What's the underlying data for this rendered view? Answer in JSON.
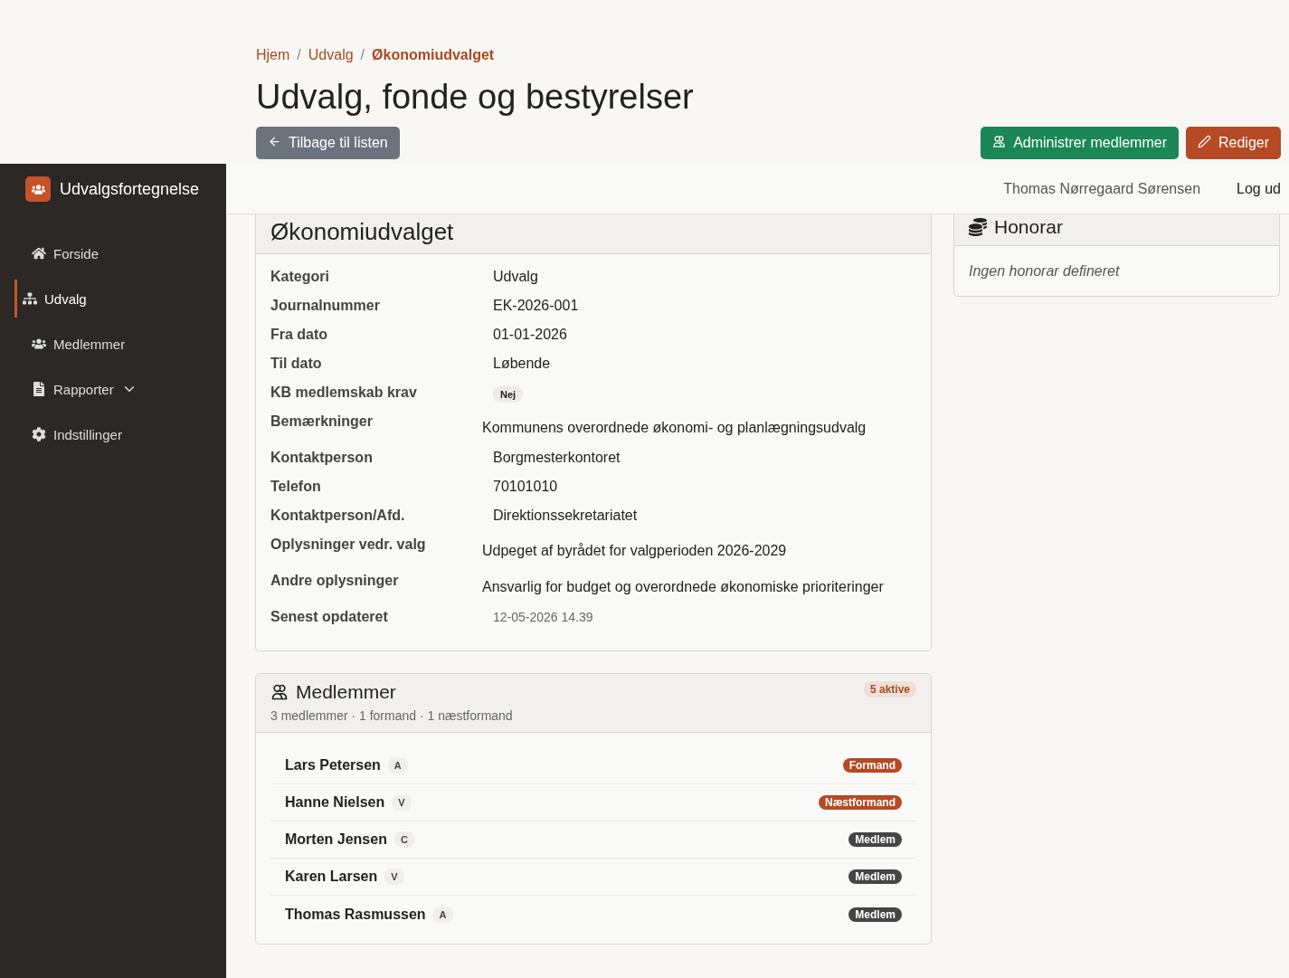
{
  "breadcrumb": [
    {
      "label": "Hjem",
      "current": false
    },
    {
      "separator": "/",
      "label": "Udvalg",
      "current": false
    },
    {
      "separator": "/",
      "label": "Økonomiudvalget",
      "current": true
    }
  ],
  "page_title": "Udvalg, fonde og bestyrelser",
  "actions": [
    {
      "label": "Tilbage til listen",
      "kind": "back"
    },
    {
      "label": "Administrer medlemmer",
      "kind": "members"
    },
    {
      "label": "Rediger",
      "kind": "edit"
    }
  ],
  "sidebar": {
    "brand": "Udvalgsfortegnelse",
    "items": [
      {
        "label": "Forside",
        "selected": false
      },
      {
        "label": "Udvalg",
        "selected": true
      },
      {
        "label": "Medlemmer",
        "selected": false
      },
      {
        "label": "Rapporter",
        "selected": false,
        "has_menu": true
      },
      {
        "label": "Indstillinger",
        "selected": false
      }
    ]
  },
  "navbar": {
    "user": "Thomas Nørregaard Sørensen",
    "logout": "Log ud"
  },
  "details": {
    "title": "Økonomiudvalget",
    "rows": [
      {
        "label": "Kategori",
        "value": "Udvalg",
        "kind": "text"
      },
      {
        "label": "Journalnummer",
        "value": "EK-2026-001",
        "kind": "text"
      },
      {
        "label": "Fra dato",
        "value": "01-01-2026",
        "kind": "text"
      },
      {
        "label": "Til dato",
        "value": "Løbende",
        "kind": "text"
      },
      {
        "label": "KB medlemskab krav",
        "value": "Nej",
        "kind": "badge"
      },
      {
        "label": "Bemærkninger",
        "value": "Kommunens overordnede økonomi- og planlægningsudvalg",
        "kind": "note"
      },
      {
        "label": "Kontaktperson",
        "value": "Borgmesterkontoret",
        "kind": "text"
      },
      {
        "label": "Telefon",
        "value": "70101010",
        "kind": "text"
      },
      {
        "label": "Kontaktperson/Afd.",
        "value": "Direktionssekretariatet",
        "kind": "text"
      },
      {
        "label": "Oplysninger vedr. valg",
        "value": "Udpeget af byrådet for valgperioden 2026-2029",
        "kind": "note"
      },
      {
        "label": "Andre oplysninger",
        "value": "Ansvarlig for budget og overordnede økonomiske prioriteringer",
        "kind": "note"
      },
      {
        "label": "Senest opdateret",
        "value": "12-05-2026 14.39",
        "kind": "muted"
      }
    ]
  },
  "members": {
    "title": "Medlemmer",
    "badge": "5 aktive",
    "summary": "3 medlemmer · 1 formand · 1 næstformand",
    "rows": [
      {
        "name": "Lars Petersen",
        "party": "A",
        "role": "Formand",
        "kind": "chair"
      },
      {
        "name": "Hanne Nielsen",
        "party": "V",
        "role": "Næstformand",
        "kind": "chair"
      },
      {
        "name": "Morten Jensen",
        "party": "C",
        "role": "Medlem",
        "kind": "member"
      },
      {
        "name": "Karen Larsen",
        "party": "V",
        "role": "Medlem",
        "kind": "member"
      },
      {
        "name": "Thomas Rasmussen",
        "party": "A",
        "role": "Medlem",
        "kind": "member"
      }
    ]
  },
  "fees": {
    "title": "Honorar",
    "empty": "Ingen honorar defineret"
  }
}
